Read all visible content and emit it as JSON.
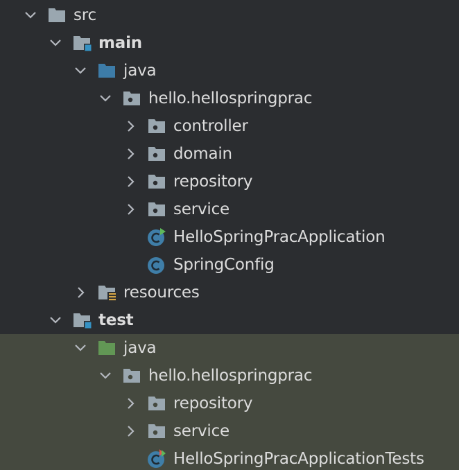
{
  "colors": {
    "background": "#2b2d30",
    "test_background": "#45493f",
    "text": "#dcdcdc",
    "folder_gray": "#9aa7b0",
    "source_root_blue": "#3d7ca8",
    "test_root_green": "#629755",
    "class_blue": "#3f7ea8",
    "module_badge": "#3592c4"
  },
  "tree": {
    "src": {
      "label": "src",
      "icon": "folder-icon",
      "expanded": true
    },
    "main": {
      "label": "main",
      "icon": "module-folder-icon",
      "expanded": true
    },
    "main_java": {
      "label": "java",
      "icon": "source-root-folder-icon",
      "expanded": true
    },
    "main_package": {
      "label": "hello.hellospringprac",
      "icon": "package-icon",
      "expanded": true
    },
    "controller": {
      "label": "controller",
      "icon": "package-icon",
      "expanded": false
    },
    "domain": {
      "label": "domain",
      "icon": "package-icon",
      "expanded": false
    },
    "main_repository": {
      "label": "repository",
      "icon": "package-icon",
      "expanded": false
    },
    "main_service": {
      "label": "service",
      "icon": "package-icon",
      "expanded": false
    },
    "app_class": {
      "label": "HelloSpringPracApplication",
      "icon": "runnable-class-icon"
    },
    "config_class": {
      "label": "SpringConfig",
      "icon": "class-icon"
    },
    "resources": {
      "label": "resources",
      "icon": "resources-folder-icon",
      "expanded": false
    },
    "test": {
      "label": "test",
      "icon": "module-folder-icon",
      "expanded": true
    },
    "test_java": {
      "label": "java",
      "icon": "test-root-folder-icon",
      "expanded": true
    },
    "test_package": {
      "label": "hello.hellospringprac",
      "icon": "package-icon",
      "expanded": true
    },
    "test_repository": {
      "label": "repository",
      "icon": "package-icon",
      "expanded": false
    },
    "test_service": {
      "label": "service",
      "icon": "package-icon",
      "expanded": false
    },
    "test_class": {
      "label": "HelloSpringPracApplicationTests",
      "icon": "test-class-icon"
    }
  }
}
